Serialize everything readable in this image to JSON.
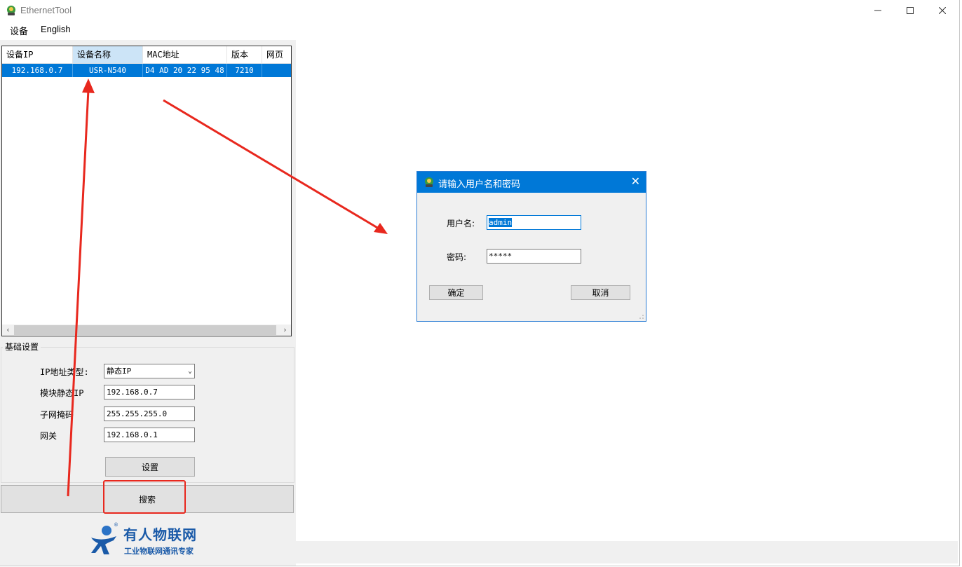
{
  "window": {
    "title": "EthernetTool",
    "icon": "app-icon",
    "controls": [
      "minimize-icon",
      "maximize-icon",
      "close-icon"
    ]
  },
  "menu": {
    "items": [
      "设备",
      "English"
    ]
  },
  "device_list": {
    "columns": [
      "设备IP",
      "设备名称",
      "MAC地址",
      "版本",
      "网页"
    ],
    "rows": [
      {
        "ip": "192.168.0.7",
        "name": "USR-N540",
        "mac": "D4 AD 20 22 95 48",
        "version": "7210",
        "web": ""
      }
    ],
    "scroll_left": "‹",
    "scroll_right": "›"
  },
  "basic_settings": {
    "title": "基础设置",
    "ip_type_label": "IP地址类型:",
    "ip_type_value": "静态IP",
    "static_ip_label": "模块静态IP",
    "static_ip_value": "192.168.0.7",
    "subnet_label": "子网掩码",
    "subnet_value": "255.255.255.0",
    "gateway_label": "网关",
    "gateway_value": "192.168.0.1",
    "set_button": "设置"
  },
  "search_button": "搜索",
  "logo": {
    "name": "有人物联网",
    "tagline": "工业物联网通讯专家"
  },
  "login_dialog": {
    "title": "请输入用户名和密码",
    "username_label": "用户名:",
    "username_value": "admin",
    "password_label": "密码:",
    "password_value": "*****",
    "ok_button": "确定",
    "cancel_button": "取消"
  },
  "colors": {
    "selection": "#0078d7",
    "annotation": "#e8281e",
    "brand": "#1a5aa8"
  }
}
